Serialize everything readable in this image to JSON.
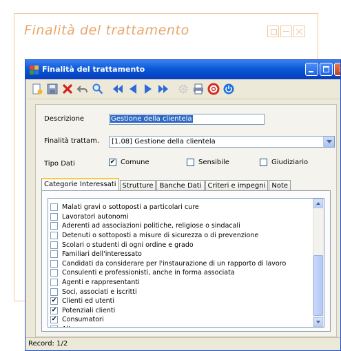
{
  "frame": {
    "title": "Finalità del trattamento"
  },
  "window": {
    "title": "Finalità del trattamento"
  },
  "form": {
    "descrizione_label": "Descrizione",
    "descrizione_value": "Gestione della clientela",
    "finalita_label": "Finalità trattam.",
    "finalita_value": "[1.08] Gestione della clientela",
    "tipo_dati_label": "Tipo Dati",
    "tipo_options": [
      {
        "label": "Comune",
        "checked": true
      },
      {
        "label": "Sensibile",
        "checked": false
      },
      {
        "label": "Giudiziario",
        "checked": false
      }
    ]
  },
  "tabs": [
    "Categorie Interessati",
    "Strutture",
    "Banche Dati",
    "Criteri e impegni",
    "Note"
  ],
  "categories": [
    {
      "label": "Malati gravi o sottoposti a particolari cure",
      "checked": false
    },
    {
      "label": "Lavoratori autonomi",
      "checked": false
    },
    {
      "label": "Aderenti ad associazioni politiche, religiose o sindacali",
      "checked": false
    },
    {
      "label": "Detenuti o sottoposti a misure di sicurezza o di prevenzione",
      "checked": false
    },
    {
      "label": "Scolari o studenti di ogni ordine e grado",
      "checked": false
    },
    {
      "label": "Familiari dell'interessato",
      "checked": false
    },
    {
      "label": "Candidati da considerare per l'instaurazione di un rapporto di lavoro",
      "checked": false
    },
    {
      "label": "Consulenti e professionisti, anche in forma associata",
      "checked": false
    },
    {
      "label": "Agenti e rappresentanti",
      "checked": false
    },
    {
      "label": "Soci, associati e iscritti",
      "checked": false
    },
    {
      "label": "Clienti ed utenti",
      "checked": true
    },
    {
      "label": "Potenziali clienti",
      "checked": true
    },
    {
      "label": "Consumatori",
      "checked": true
    },
    {
      "label": "Altro",
      "checked": false
    }
  ],
  "status": {
    "record": "Record: 1/2"
  },
  "colors": {
    "accent": "#e7a66a",
    "titlebar": "#0a5ad9",
    "selection": "#316ac5"
  },
  "toolbar_icons": [
    "new-icon",
    "save-icon",
    "delete-icon",
    "undo-icon",
    "search-icon",
    "first-icon",
    "prev-icon",
    "next-icon",
    "last-icon",
    "settings-icon",
    "print-icon",
    "help-icon",
    "power-icon"
  ]
}
